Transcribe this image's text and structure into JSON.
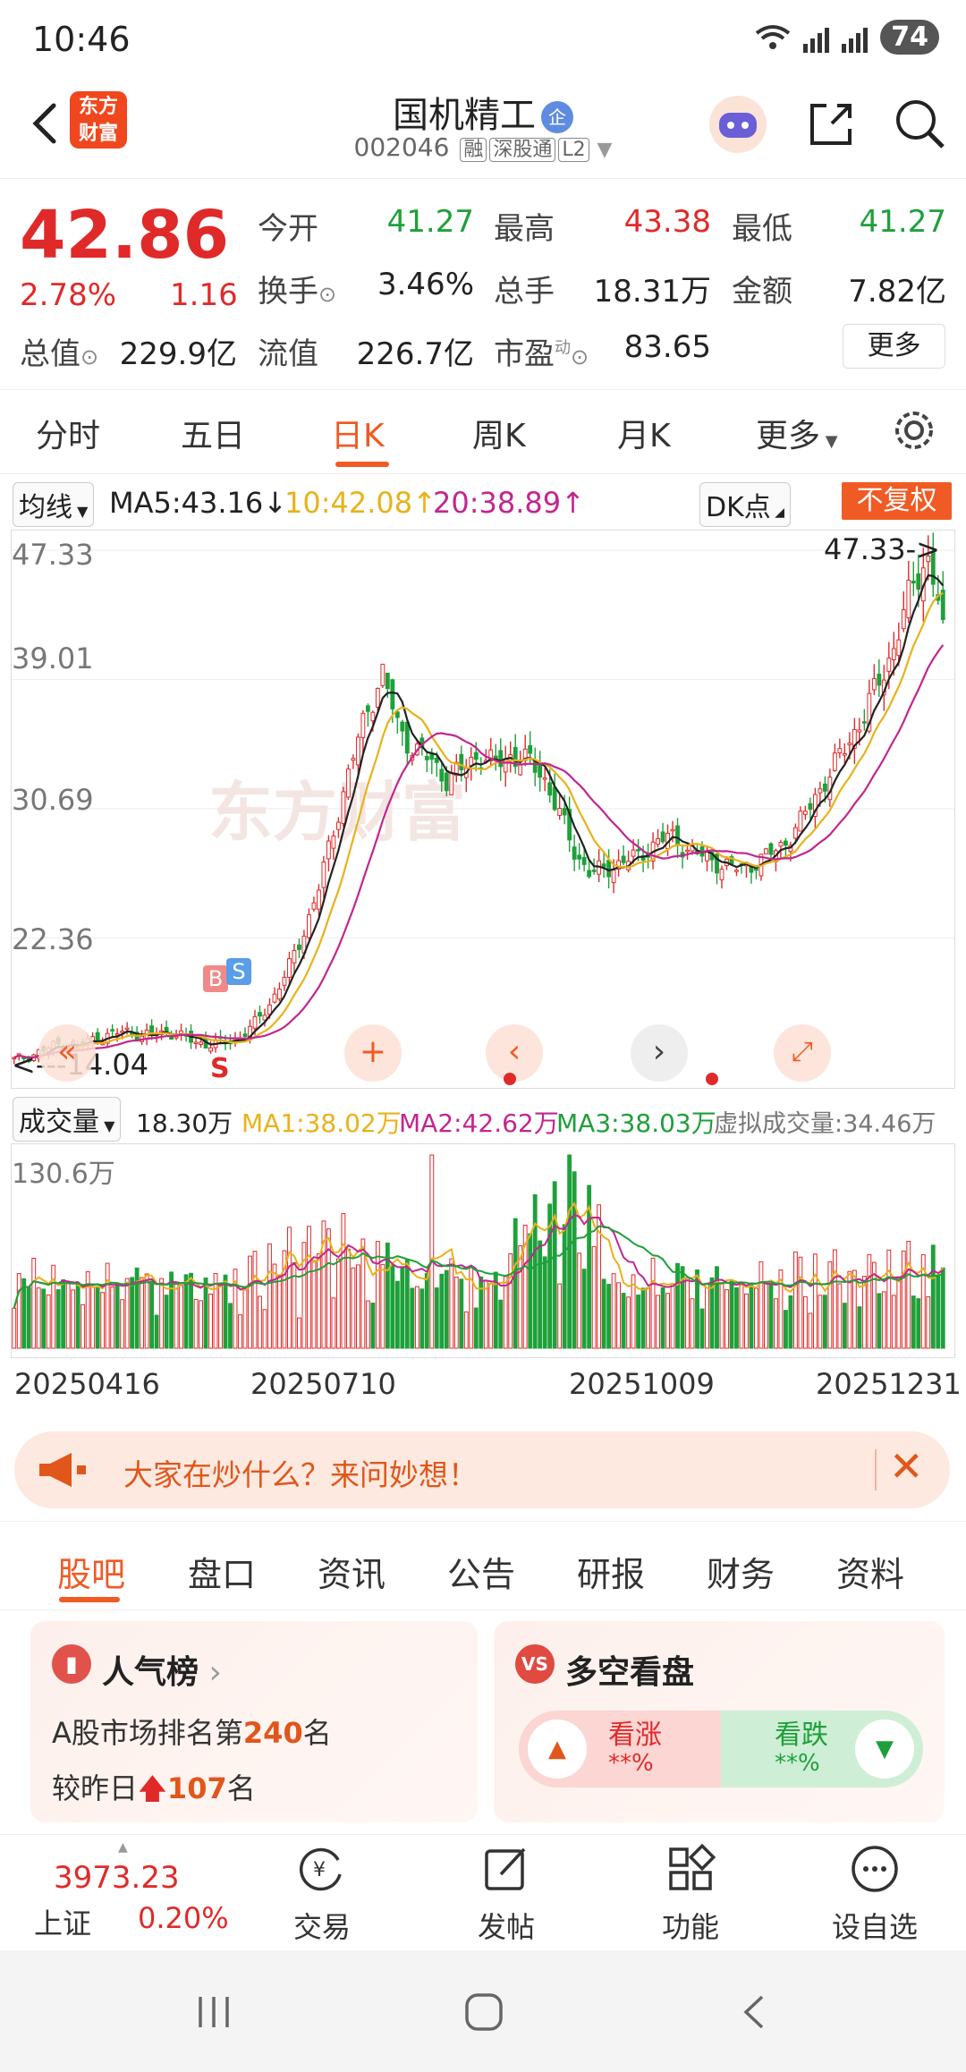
{
  "status": {
    "time": "10:46",
    "signal1": "5G",
    "signal2": "5G",
    "battery": "74"
  },
  "header": {
    "logo_line1": "东方",
    "logo_line2": "财富",
    "name": "国机精工",
    "name_badge": "企",
    "code": "002046",
    "tags": [
      "融",
      "深股通",
      "L2"
    ]
  },
  "quote": {
    "price": "42.86",
    "change_pct": "2.78%",
    "change": "1.16",
    "open_label": "今开",
    "open": "41.27",
    "high_label": "最高",
    "high": "43.38",
    "low_label": "最低",
    "low": "41.27",
    "turnover_label": "换手",
    "turnover": "3.46%",
    "volume_label": "总手",
    "volume": "18.31万",
    "amount_label": "金额",
    "amount": "7.82亿",
    "mktcap_label": "总值",
    "mktcap": "229.9亿",
    "float_label": "流值",
    "float": "226.7亿",
    "pe_label": "市盈",
    "pe_sup": "动",
    "pe": "83.65",
    "more": "更多"
  },
  "period_tabs": [
    "分时",
    "五日",
    "日K",
    "周K",
    "月K",
    "更多"
  ],
  "active_period": "日K",
  "ma_bar": {
    "selector": "均线",
    "ma5": "MA5:43.16",
    "ma10": "10:42.08",
    "ma20": "20:38.89",
    "dk": "DK点",
    "adjust": "不复权"
  },
  "colors": {
    "up": "#e02a2a",
    "down": "#1ea03a",
    "ma5": "#222222",
    "ma10": "#e8b21a",
    "ma20": "#c2268f",
    "accent": "#f05a24"
  },
  "kchart": {
    "y_labels": [
      "47.33",
      "39.01",
      "30.69",
      "22.36"
    ],
    "max_label": "47.33->",
    "min_label": "<---14.04",
    "buy": "B",
    "sell": "S",
    "sell2": "S",
    "watermark": "东方财富"
  },
  "chart_data": {
    "type": "candlestick",
    "ylim": [
      14.04,
      47.33
    ],
    "close_path": [
      14.5,
      14.8,
      15.2,
      15.6,
      15.4,
      15.9,
      16.1,
      16.4,
      16.0,
      16.3,
      16.2,
      15.8,
      15.5,
      15.6,
      15.9,
      16.8,
      18.2,
      20.1,
      22.5,
      25.5,
      29.5,
      33.5,
      36.8,
      39.5,
      35.8,
      34.5,
      33.8,
      32.6,
      33.2,
      34.2,
      33.5,
      34.1,
      33.8,
      32.9,
      30.5,
      27.9,
      26.5,
      26.8,
      27.3,
      27.6,
      28.5,
      28.9,
      28.1,
      27.6,
      27.2,
      26.8,
      27.1,
      27.6,
      28.4,
      29.6,
      31.5,
      33.0,
      34.9,
      36.5,
      38.9,
      41.2,
      44.8,
      47.0,
      42.86
    ],
    "volume_ylim": [
      0,
      130.6
    ],
    "volume": {
      "value": "18.30万",
      "ma1": "MA1:38.02万",
      "ma2": "MA2:42.62万",
      "ma3": "MA3:38.03万",
      "virtual": "虚拟成交量:34.46万"
    },
    "volume_max_label": "130.6万",
    "x_dates": [
      "20250416",
      "20250710",
      "20251009",
      "20251231"
    ]
  },
  "vol_selector": "成交量",
  "banner": {
    "text": "大家在炒什么？来问妙想！"
  },
  "info_tabs": [
    "股吧",
    "盘口",
    "资讯",
    "公告",
    "研报",
    "财务",
    "资料"
  ],
  "active_info_tab": "股吧",
  "popularity": {
    "title": "人气榜",
    "rank_prefix": "A股市场排名第",
    "rank": "240",
    "rank_suffix": "名",
    "delta_prefix": "较昨日",
    "delta": "107",
    "delta_suffix": "名"
  },
  "sentiment": {
    "title": "多空看盘",
    "bull": "看涨",
    "bull_val": "**%",
    "bear": "看跌",
    "bear_val": "**%",
    "vs": "VS"
  },
  "bottom_nav": {
    "index_value": "3973.23",
    "index_name": "上证",
    "index_pct": "0.20%",
    "trade": "交易",
    "post": "发帖",
    "func": "功能",
    "watch": "设自选"
  }
}
